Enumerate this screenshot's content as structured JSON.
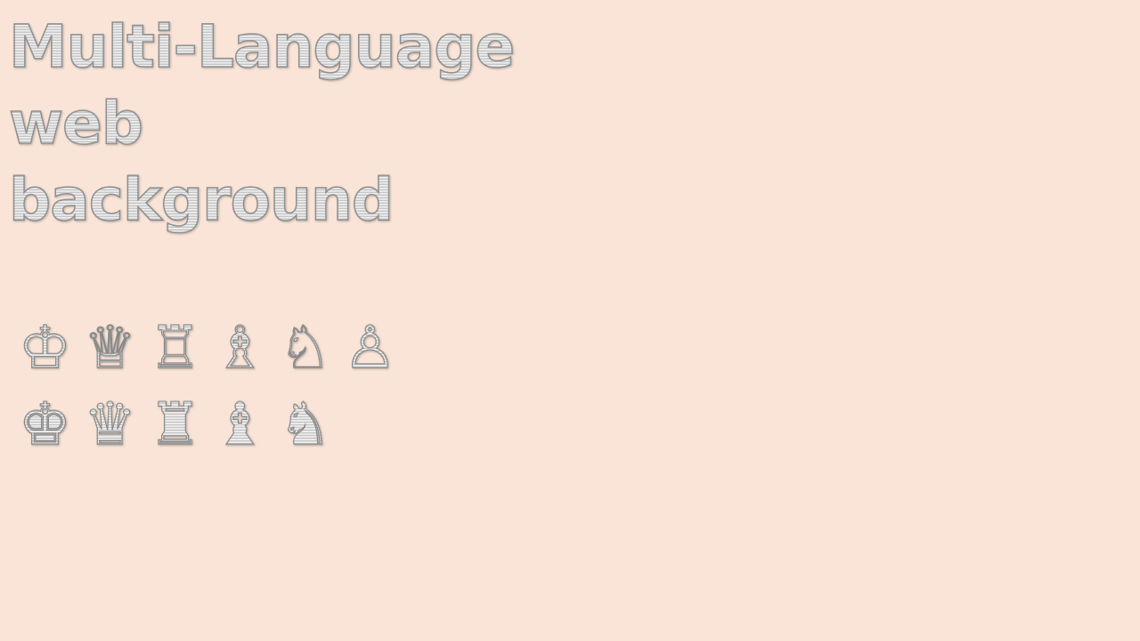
{
  "colors": {
    "background": "#f9e4d7",
    "text_fill": "#dcdcdc",
    "text_outline": "#8f8f8f"
  },
  "title": {
    "lines": [
      "Multi-Language",
      "web",
      "background"
    ]
  },
  "pieces": {
    "row1": [
      {
        "name": "king-outline-icon",
        "glyph": "♔"
      },
      {
        "name": "queen-outline-icon",
        "glyph": "♕"
      },
      {
        "name": "rook-outline-icon",
        "glyph": "♖"
      },
      {
        "name": "bishop-outline-icon",
        "glyph": "♗"
      },
      {
        "name": "knight-outline-icon",
        "glyph": "♘"
      },
      {
        "name": "pawn-outline-icon",
        "glyph": "♙"
      }
    ],
    "row2": [
      {
        "name": "king-solid-icon",
        "glyph": "♚"
      },
      {
        "name": "queen-solid-icon",
        "glyph": "♛"
      },
      {
        "name": "rook-solid-icon",
        "glyph": "♜"
      },
      {
        "name": "bishop-solid-icon",
        "glyph": "♝"
      },
      {
        "name": "knight-solid-icon",
        "glyph": "♞"
      }
    ]
  }
}
